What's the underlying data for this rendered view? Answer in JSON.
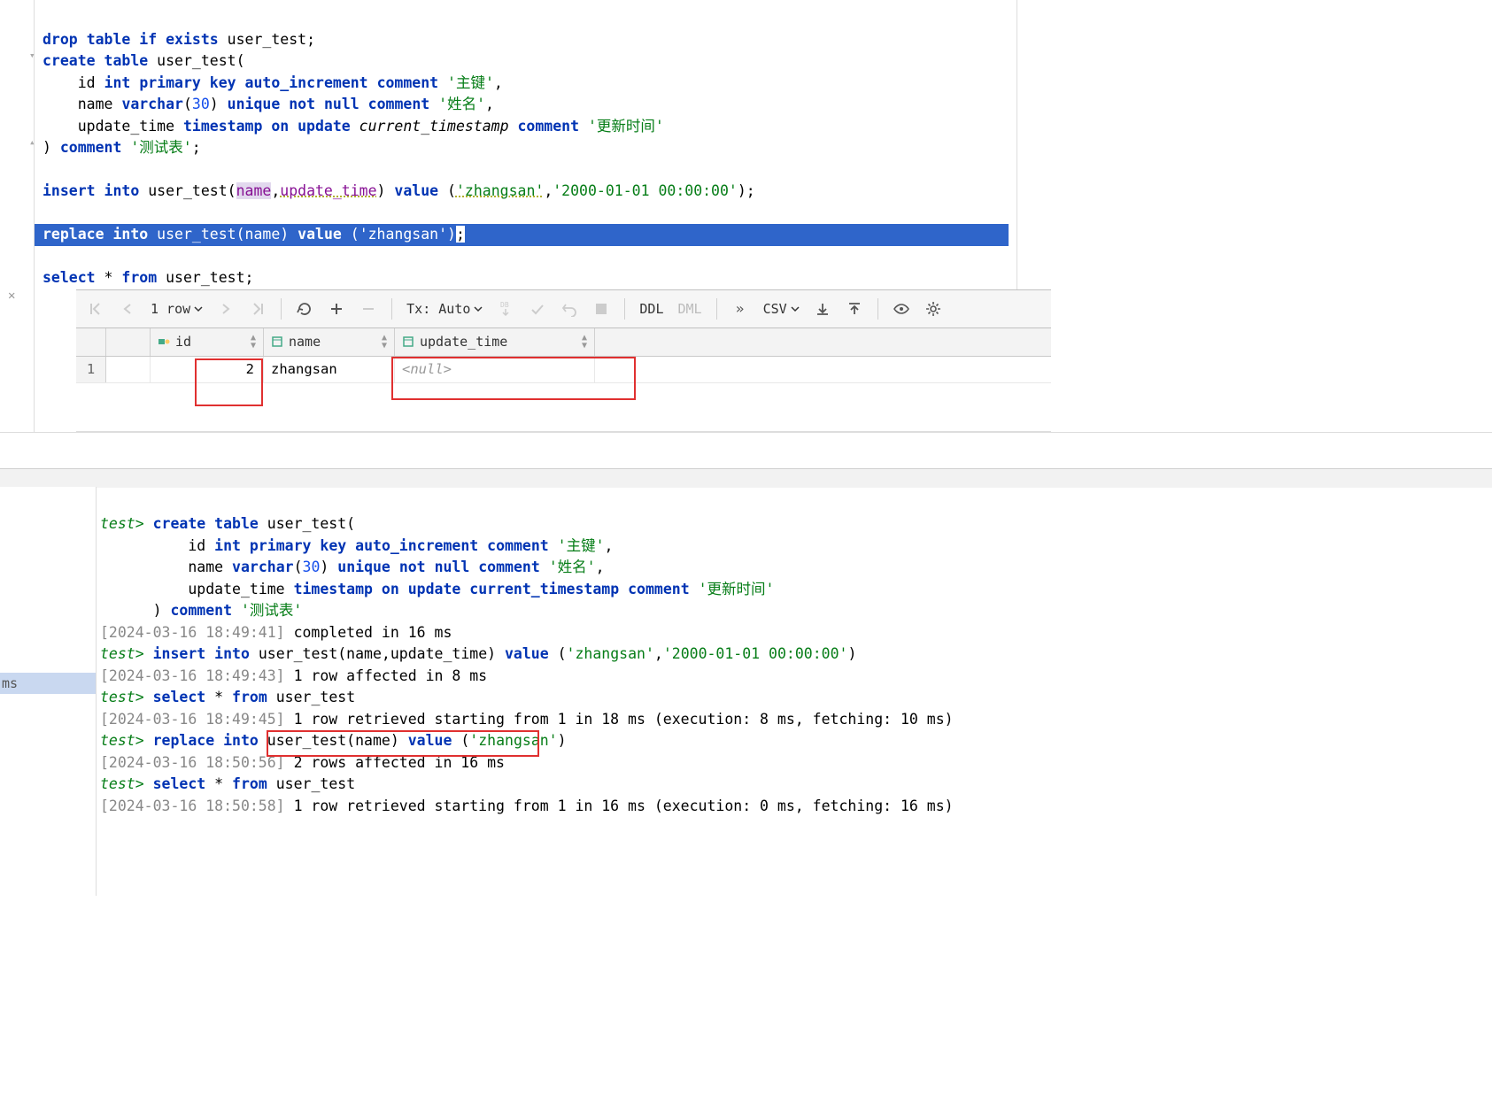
{
  "editor": {
    "drop_table": {
      "drop": "drop",
      "table": "table",
      "if": "if",
      "exists": "exists",
      "tbl": "user_test"
    },
    "create_table": {
      "create": "create",
      "table": "table",
      "tbl": "user_test"
    },
    "id_line": {
      "col": "id",
      "int": "int",
      "pk": "primary",
      "key": "key",
      "ai": "auto_increment",
      "comment": "comment",
      "val": "'主键'"
    },
    "name_line": {
      "col": "name",
      "varchar": "varchar",
      "size": "30",
      "unique": "unique",
      "not": "not",
      "null": "null",
      "comment": "comment",
      "val": "'姓名'"
    },
    "update_line": {
      "col": "update_time",
      "ts": "timestamp",
      "on": "on",
      "update": "update",
      "cts": "current_timestamp",
      "comment": "comment",
      "val": "'更新时间'"
    },
    "close_line": {
      "comment": "comment",
      "val": "'测试表'"
    },
    "insert_line": {
      "insert": "insert",
      "into": "into",
      "tbl": "user_test",
      "c1": "name",
      "c2": "update_time",
      "value": "value",
      "v1": "'zhangsan'",
      "v2": "'2000-01-01 00:00:00'"
    },
    "replace_line": {
      "replace": "replace",
      "into": "into",
      "tbl": "user_test",
      "c1": "name",
      "value": "value",
      "v1": "'zhangsan'"
    },
    "select_line": {
      "select": "select",
      "star": "*",
      "from": "from",
      "tbl": "user_test"
    }
  },
  "toolbar": {
    "row_label": "1 row",
    "tx_label": "Tx: Auto",
    "ddl": "DDL",
    "dml": "DML",
    "csv": "CSV"
  },
  "grid": {
    "headers": {
      "id": "id",
      "name": "name",
      "update": "update_time"
    },
    "row1": {
      "num": "1",
      "id": "2",
      "name": "zhangsan",
      "update": "<null>"
    }
  },
  "console": {
    "left_label": "ms",
    "l1": {
      "prompt": "test>",
      "create": "create",
      "table": "table",
      "tbl": "user_test("
    },
    "l2": {
      "col": "id",
      "int": "int",
      "pk": "primary",
      "key": "key",
      "ai": "auto_increment",
      "comment": "comment",
      "val": "'主键'",
      "comma": ","
    },
    "l3": {
      "col": "name",
      "varchar": "varchar",
      "size": "30",
      "unique": "unique",
      "not": "not",
      "null": "null",
      "comment": "comment",
      "val": "'姓名'",
      "comma": ","
    },
    "l4": {
      "col": "update_time",
      "ts": "timestamp",
      "on": "on",
      "update": "update",
      "cts": "current_timestamp",
      "comment": "comment",
      "val": "'更新时间'"
    },
    "l5": {
      "close": ")",
      "comment": "comment",
      "val": "'测试表'"
    },
    "l6": {
      "ts": "[2024-03-16 18:49:41]",
      "msg": "completed in 16 ms"
    },
    "l7": {
      "prompt": "test>",
      "insert": "insert",
      "into": "into",
      "tbl": "user_test(name,update_time)",
      "value": "value",
      "args": "(",
      "v1": "'zhangsan'",
      "comma": ",",
      "v2": "'2000-01-01 00:00:00'",
      "close": ")"
    },
    "l8": {
      "ts": "[2024-03-16 18:49:43]",
      "msg": "1 row affected in 8 ms"
    },
    "l9": {
      "prompt": "test>",
      "select": "select",
      "star": "*",
      "from": "from",
      "tbl": "user_test"
    },
    "l10": {
      "ts": "[2024-03-16 18:49:45]",
      "msg": "1 row retrieved starting from 1 in 18 ms (execution: 8 ms, fetching: 10 ms)"
    },
    "l11": {
      "prompt": "test>",
      "replace": "replace",
      "into": "into",
      "tbl": "user_test(name)",
      "value": "value",
      "args": "(",
      "v1": "'zhangsan'",
      "close": ")"
    },
    "l12": {
      "ts": "[2024-03-16 18:50:56]",
      "msg": "2 rows affected in 16 ms"
    },
    "l13": {
      "prompt": "test>",
      "select": "select",
      "star": "*",
      "from": "from",
      "tbl": "user_test"
    },
    "l14": {
      "ts": "[2024-03-16 18:50:58]",
      "msg": "1 row retrieved starting from 1 in 16 ms (execution: 0 ms, fetching: 16 ms)"
    }
  }
}
